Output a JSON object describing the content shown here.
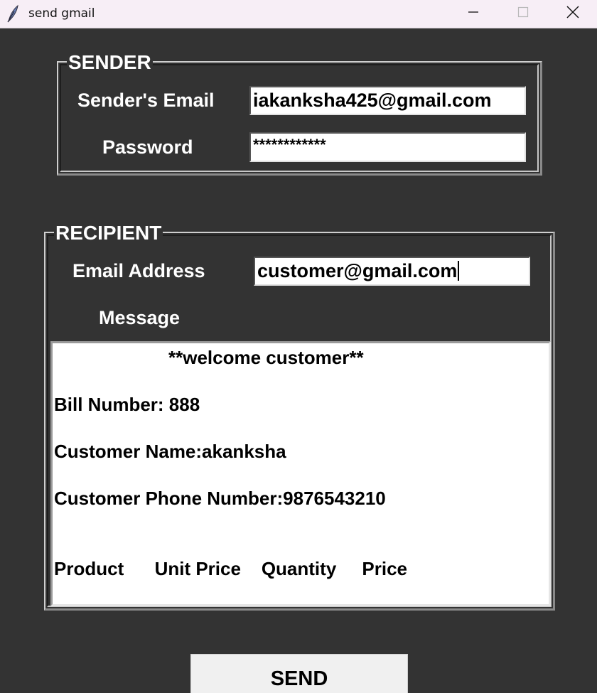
{
  "window": {
    "title": "send gmail"
  },
  "sender": {
    "frame_title": "SENDER",
    "email_label": "Sender's Email",
    "email_value": "iakanksha425@gmail.com",
    "password_label": "Password",
    "password_value": "************"
  },
  "recipient": {
    "frame_title": "RECIPIENT",
    "email_label": "Email Address",
    "email_value": "customer@gmail.com",
    "message_label": "Message",
    "message_lines": [
      "**welcome customer**",
      "Bill Number: 888",
      "Customer Name:akanksha",
      "Customer Phone Number:9876543210",
      "Product      Unit Price    Quantity     Price"
    ]
  },
  "actions": {
    "send_label": "SEND"
  },
  "colors": {
    "background": "#333333",
    "titlebar": "#f7eef6",
    "text_light": "#ffffff",
    "entry_bg": "#ffffff",
    "button_bg": "#f0f0f0"
  },
  "icons": {
    "app": "feather-icon",
    "minimize": "minimize-icon",
    "maximize": "maximize-icon",
    "close": "close-icon"
  }
}
